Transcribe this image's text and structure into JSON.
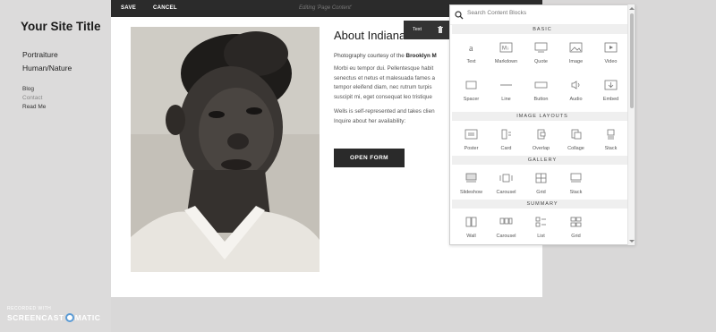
{
  "site": {
    "title": "Your Site Title",
    "nav_main": [
      "Portraiture",
      "Human/Nature"
    ],
    "nav_sub": [
      "Blog",
      "Contact",
      "Read Me"
    ]
  },
  "toolbar": {
    "save_label": "SAVE",
    "cancel_label": "CANCEL",
    "status": "Editing 'Page Content'"
  },
  "content": {
    "title": "About Indiana",
    "credit_prefix": "Photography courtesy of the",
    "credit_link": "Brooklyn M",
    "para1": [
      "Morbi eu tempor dui. Pellentesque habit",
      "senectus et netus et malesuada fames a",
      "tempor eleifend diam, nec rutrum turpis",
      "suscipit mi, eget consequat leo tristique"
    ],
    "para2": [
      "Wells is self-represented and takes clien",
      "Inquire about her availability:"
    ],
    "button_label": "OPEN FORM"
  },
  "block_tab": {
    "label": "Text"
  },
  "panel": {
    "search_placeholder": "Search Content Blocks",
    "sections": [
      {
        "title": "BASIC",
        "items": [
          {
            "label": "Text",
            "icon": "text-icon"
          },
          {
            "label": "Markdown",
            "icon": "markdown-icon"
          },
          {
            "label": "Quote",
            "icon": "quote-icon"
          },
          {
            "label": "Image",
            "icon": "image-icon"
          },
          {
            "label": "Video",
            "icon": "video-icon"
          },
          {
            "label": "Spacer",
            "icon": "spacer-icon"
          },
          {
            "label": "Line",
            "icon": "line-icon"
          },
          {
            "label": "Button",
            "icon": "button-icon"
          },
          {
            "label": "Audio",
            "icon": "audio-icon"
          },
          {
            "label": "Embed",
            "icon": "embed-icon"
          }
        ]
      },
      {
        "title": "IMAGE LAYOUTS",
        "items": [
          {
            "label": "Poster",
            "icon": "poster-icon"
          },
          {
            "label": "Card",
            "icon": "card-icon"
          },
          {
            "label": "Overlap",
            "icon": "overlap-icon"
          },
          {
            "label": "Collage",
            "icon": "collage-icon"
          },
          {
            "label": "Stack",
            "icon": "stack-icon"
          }
        ]
      },
      {
        "title": "GALLERY",
        "items": [
          {
            "label": "Slideshow",
            "icon": "slideshow-icon"
          },
          {
            "label": "Carousel",
            "icon": "carousel-icon"
          },
          {
            "label": "Grid",
            "icon": "grid-icon"
          },
          {
            "label": "Stack",
            "icon": "stack-icon"
          }
        ]
      },
      {
        "title": "SUMMARY",
        "items": [
          {
            "label": "Wall",
            "icon": "wall-icon"
          },
          {
            "label": "Carousel",
            "icon": "carousel-icon"
          },
          {
            "label": "List",
            "icon": "list-icon"
          },
          {
            "label": "Grid",
            "icon": "grid-icon"
          }
        ]
      }
    ]
  },
  "watermark": {
    "top": "RECORDED WITH",
    "left": "SCREENCAST",
    "right": "MATIC"
  }
}
